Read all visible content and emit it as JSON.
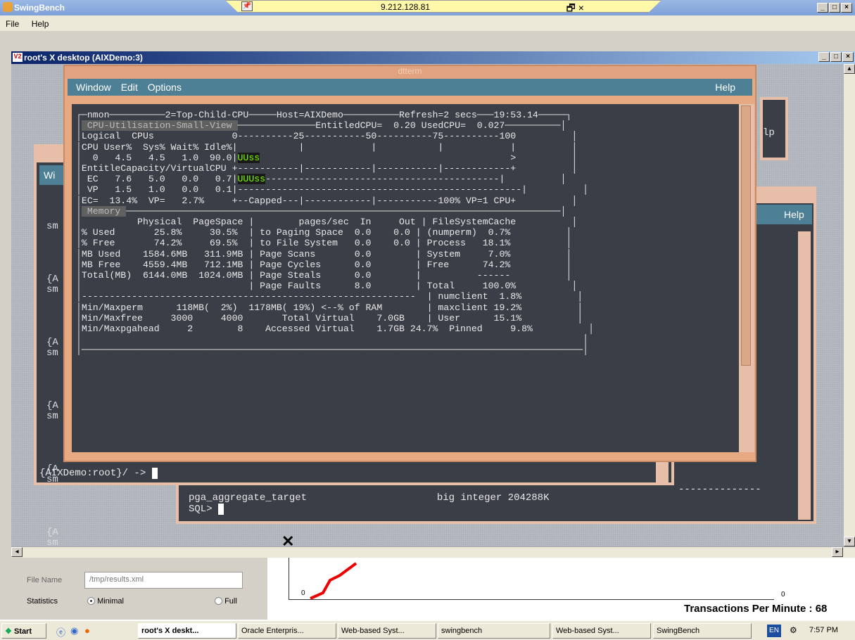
{
  "swingbench": {
    "title": "SwingBench",
    "menu": [
      "File",
      "Help"
    ]
  },
  "vnc_toolbar": {
    "ip": "9.212.128.81",
    "controls": "_ 🗗 ×"
  },
  "vnc_window": {
    "title": "root's X desktop (AIXDemo:3)"
  },
  "dtterm": {
    "title": "dtterm",
    "menu": [
      "Window",
      "Edit",
      "Options"
    ],
    "help": "Help"
  },
  "nmon": {
    "lines": [
      "┌─nmon──────────2=Top-Child-CPU─────Host=AIXDemo──────────Refresh=2 secs───19:53.14─────┐",
      "│ CPU-Utilisation-Small-View ──────────────EntitledCPU=  0.20 UsedCPU=  0.027──────────│",
      "│Logical  CPUs              0----------25-----------50----------75----------100          │",
      "│CPU User%  Sys% Wait% Idle%|           |            |           |            |          │",
      "│  0   4.5   4.5   1.0  90.0|UUss                                             >          │",
      "│EntitleCapacity/VirtualCPU +-----------|------------|-----------|------------+          │",
      "│ EC   7.6   5.0   0.0   0.7|UUUss------------------------------------------|          │",
      "│ VP   1.5   1.0   0.0   0.1|---------------------------------------------------|          │",
      "│EC=  13.4%  VP=   2.7%     +--Capped---|------------|-----------100% VP=1 CPU+          │",
      "│ Memory ──────────────────────────────────────────────────────────────────────────────│",
      "│          Physical  PageSpace |        pages/sec  In     Out | FileSystemCache          │",
      "│% Used       25.8%     30.5%  | to Paging Space  0.0    0.0 | (numperm)  0.7%          │",
      "│% Free       74.2%     69.5%  | to File System   0.0    0.0 | Process   18.1%          │",
      "│MB Used    1584.6MB   311.9MB | Page Scans       0.0        | System     7.0%          │",
      "│MB Free    4559.4MB   712.1MB | Page Cycles      0.0        | Free      74.2%          │",
      "│Total(MB)  6144.0MB  1024.0MB | Page Steals      0.0        |          ------          │",
      "│                              | Page Faults      8.0        | Total     100.0%          │",
      "│------------------------------------------------------------  | numclient  1.8%          │",
      "│Min/Maxperm      118MB(  2%)  1178MB( 19%) <--% of RAM        | maxclient 19.2%          │",
      "│Min/Maxfree     3000     4000       Total Virtual    7.0GB    | User      15.1%          │",
      "│Min/Maxpgahead     2        8    Accessed Virtual    1.7GB 24.7%  Pinned     9.8%          │",
      "│                                                                                          │",
      "│──────────────────────────────────────────────────────────────────────────────────────────│"
    ]
  },
  "back_terminal": {
    "prompt": "{AIXDemo:root}/ -> ",
    "partial": [
      "sm",
      "{A",
      "sm",
      "{A",
      "sm",
      "{A",
      "sm",
      "{A",
      "sm",
      "{A",
      "sm"
    ],
    "wi": "Wi"
  },
  "sql_terminal": {
    "line1": "pga_aggregate_target                      big integer 204288K",
    "line2": "SQL> ",
    "help": "Help",
    "partial_p": "lp",
    "dashes": "--------------"
  },
  "bottom_panel": {
    "file_name_label": "File Name",
    "file_name_value": "/tmp/results.xml",
    "statistics_label": "Statistics",
    "radio_minimal": "Minimal",
    "radio_full": "Full",
    "chart_zero_left": "0",
    "chart_zero_right": "0",
    "tpm": "Transactions Per Minute : 68"
  },
  "taskbar": {
    "start": "Start",
    "tasks": [
      "root's X deskt...",
      "Oracle Enterpris...",
      "Web-based Syst...",
      "swingbench",
      "Web-based Syst...",
      "SwingBench"
    ],
    "lang": "EN",
    "clock": "7:57 PM"
  }
}
